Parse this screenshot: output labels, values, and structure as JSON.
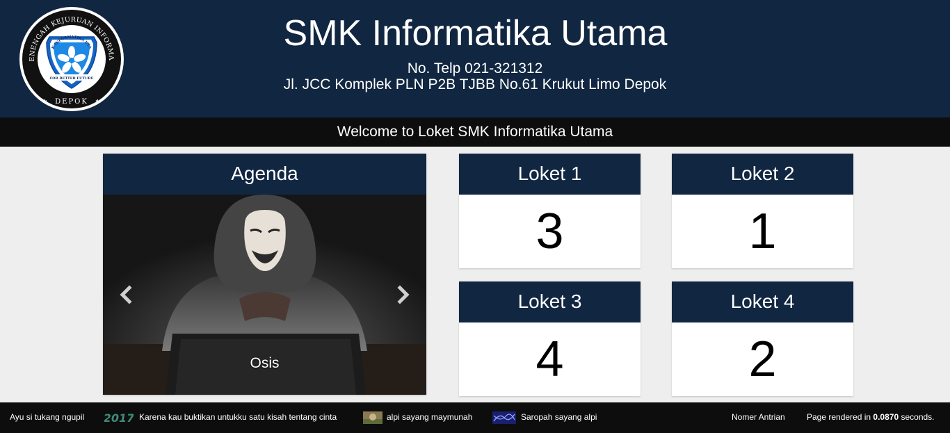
{
  "header": {
    "school_name": "SMK Informatika Utama",
    "phone": "No. Telp 021-321312",
    "address": "Jl. JCC Komplek PLN P2B TJBB No.61 Krukut Limo Depok",
    "logo": {
      "ring_text": "SEKOLAH MENENGAH KEJURUAN INFORMATIKA UTAMA",
      "bottom_text": "DEPOK",
      "shield_top": "SMK INFORMATIKA UTAMA",
      "shield_bottom": "FOR BETTER FUTURE"
    }
  },
  "welcome": "Welcome to Loket SMK Informatika Utama",
  "agenda": {
    "title": "Agenda",
    "caption": "Osis",
    "prev_icon": "chevron-left-icon",
    "next_icon": "chevron-right-icon"
  },
  "lokets": [
    {
      "label": "Loket 1",
      "number": "3"
    },
    {
      "label": "Loket 2",
      "number": "1"
    },
    {
      "label": "Loket 3",
      "number": "4"
    },
    {
      "label": "Loket 4",
      "number": "2"
    }
  ],
  "footer": {
    "ticker": [
      {
        "text": "Ayu si tukang ngupil"
      },
      {
        "badge": "2017",
        "text": "Karena kau buktikan untukku satu kisah tentang cinta"
      },
      {
        "text": "alpi sayang maymunah"
      },
      {
        "text": "Saropah sayang alpi"
      }
    ],
    "queue_label": "Nomer Antrian",
    "render_prefix": "Page rendered in",
    "render_time": "0.0870",
    "render_suffix": "seconds."
  },
  "colors": {
    "navy": "#112641",
    "bar_black": "#0d0d0d",
    "page_bg": "#eeeeee"
  }
}
